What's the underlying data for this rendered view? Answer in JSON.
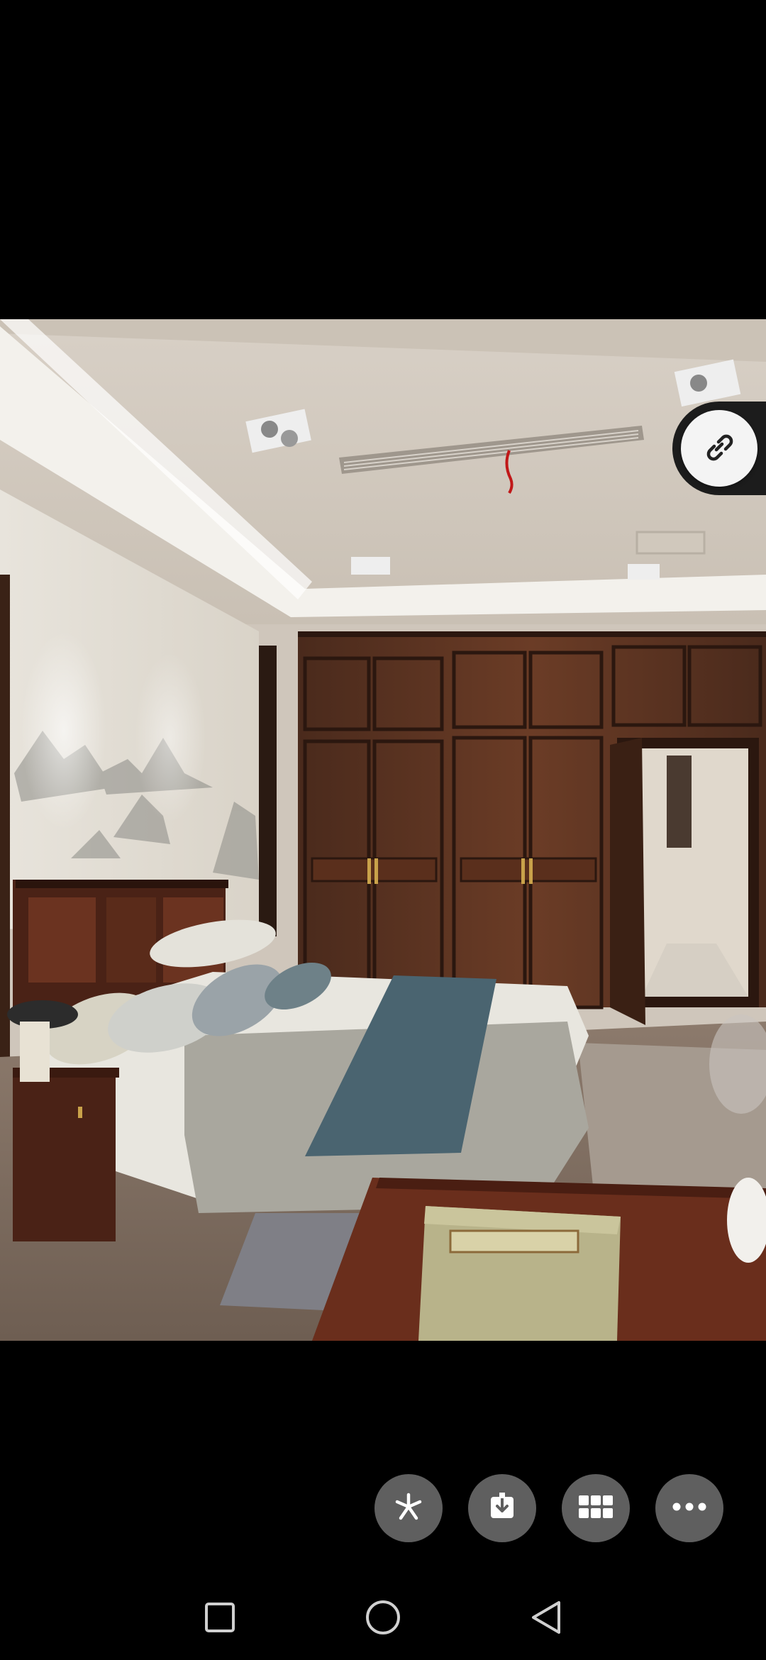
{
  "viewer": {
    "image_subject": "bedroom-interior-photo",
    "overlay": {
      "link_icon": "link-icon"
    },
    "actions": [
      {
        "icon": "pinwheel-icon",
        "name": "share-button"
      },
      {
        "icon": "download-icon",
        "name": "download-button"
      },
      {
        "icon": "grid-icon",
        "name": "gallery-button"
      },
      {
        "icon": "more-icon",
        "name": "more-button"
      }
    ]
  },
  "system_nav": {
    "buttons": [
      {
        "icon": "square-icon",
        "name": "recent-apps-button"
      },
      {
        "icon": "circle-icon",
        "name": "home-button"
      },
      {
        "icon": "triangle-back-icon",
        "name": "back-button"
      }
    ]
  },
  "colors": {
    "background": "#000000",
    "action_button": "#5f5f5f",
    "link_button": "#f4f4f4"
  }
}
